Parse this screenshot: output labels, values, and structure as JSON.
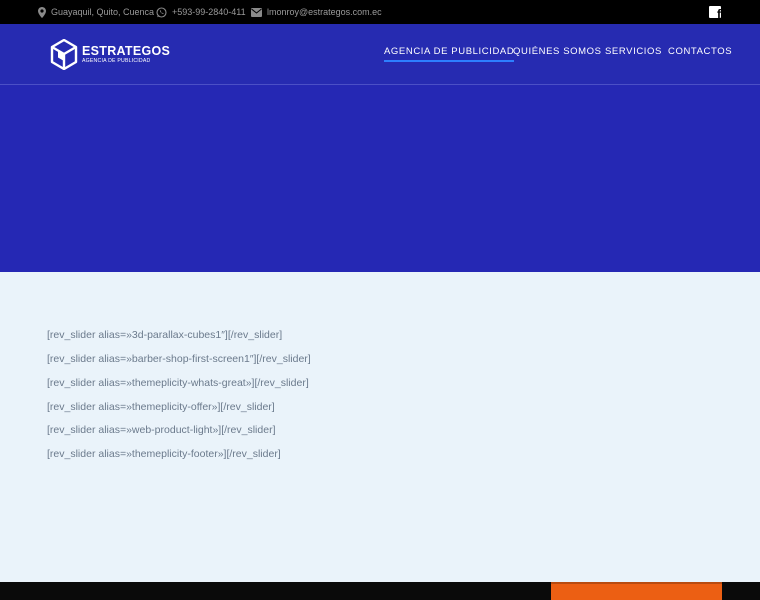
{
  "topbar": {
    "location": "Guayaquil, Quito, Cuenca",
    "phone": "+593-99-2840-411",
    "email": "lmonroy@estrategos.com.ec",
    "icons": {
      "location": "map-pin-icon",
      "phone": "whatsapp-icon",
      "email": "envelope-icon",
      "social": "facebook-icon"
    }
  },
  "logo": {
    "name": "ESTRATEGOS",
    "tagline": "AGENCIA DE PUBLICIDAD"
  },
  "nav": {
    "items": [
      {
        "label": "AGENCIA DE PUBLICIDAD",
        "active": true
      },
      {
        "label": "QUIÉNES SOMOS",
        "active": false
      },
      {
        "label": "SERVICIOS",
        "active": false
      },
      {
        "label": "CONTACTOS",
        "active": false
      }
    ]
  },
  "content": {
    "shortcodes": [
      "[rev_slider alias=»3d-parallax-cubes1″][/rev_slider]",
      "[rev_slider alias=»barber-shop-first-screen1″][/rev_slider]",
      "[rev_slider alias=»themeplicity-whats-great»][/rev_slider]",
      "[rev_slider alias=»themeplicity-offer»][/rev_slider]",
      "[rev_slider alias=»web-product-light»][/rev_slider]",
      "[rev_slider alias=»themeplicity-footer»][/rev_slider]"
    ]
  },
  "colors": {
    "topbar": "#000000",
    "header": "#262bb1",
    "hero": "#2528b4",
    "content_bg": "#eaf3fa",
    "nav_active_underline": "#2d7fff",
    "footer_accent": "#ec5f13"
  }
}
